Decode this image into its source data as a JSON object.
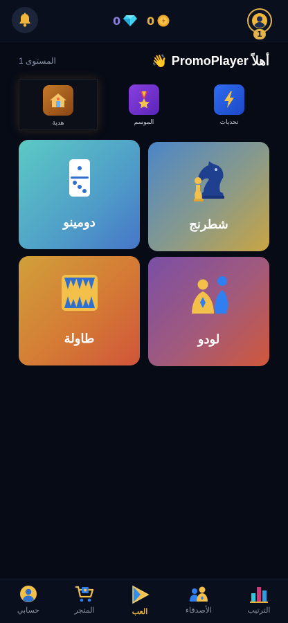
{
  "header": {
    "gems_count": "0",
    "coins_count": "0",
    "profile_level": "1"
  },
  "welcome": {
    "greeting": "أهلاً PromoPlayer",
    "wave_emoji": "👋",
    "level_label": "المستوى 1"
  },
  "quick_actions": [
    {
      "label": "هدية",
      "icon": "gift-house-icon"
    },
    {
      "label": "الموسم",
      "icon": "medal-icon"
    },
    {
      "label": "تحديات",
      "icon": "lightning-icon"
    }
  ],
  "games": [
    {
      "name": "شطرنج",
      "icon": "chess-knight-icon"
    },
    {
      "name": "دومينو",
      "icon": "domino-icon"
    },
    {
      "name": "لودو",
      "icon": "ludo-pawns-icon"
    },
    {
      "name": "طاولة",
      "icon": "backgammon-icon"
    }
  ],
  "bottom_nav": [
    {
      "label": "الترتيب",
      "icon": "leaderboard-icon",
      "active": false
    },
    {
      "label": "الأصدقاء",
      "icon": "friends-icon",
      "active": false
    },
    {
      "label": "العب",
      "icon": "play-icon",
      "active": true
    },
    {
      "label": "المتجر",
      "icon": "cart-icon",
      "active": false
    },
    {
      "label": "حسابي",
      "icon": "account-icon",
      "active": false
    }
  ],
  "colors": {
    "background": "#070b16",
    "accent_gold": "#e9b23a",
    "gem_purple": "#8b7fd8"
  }
}
